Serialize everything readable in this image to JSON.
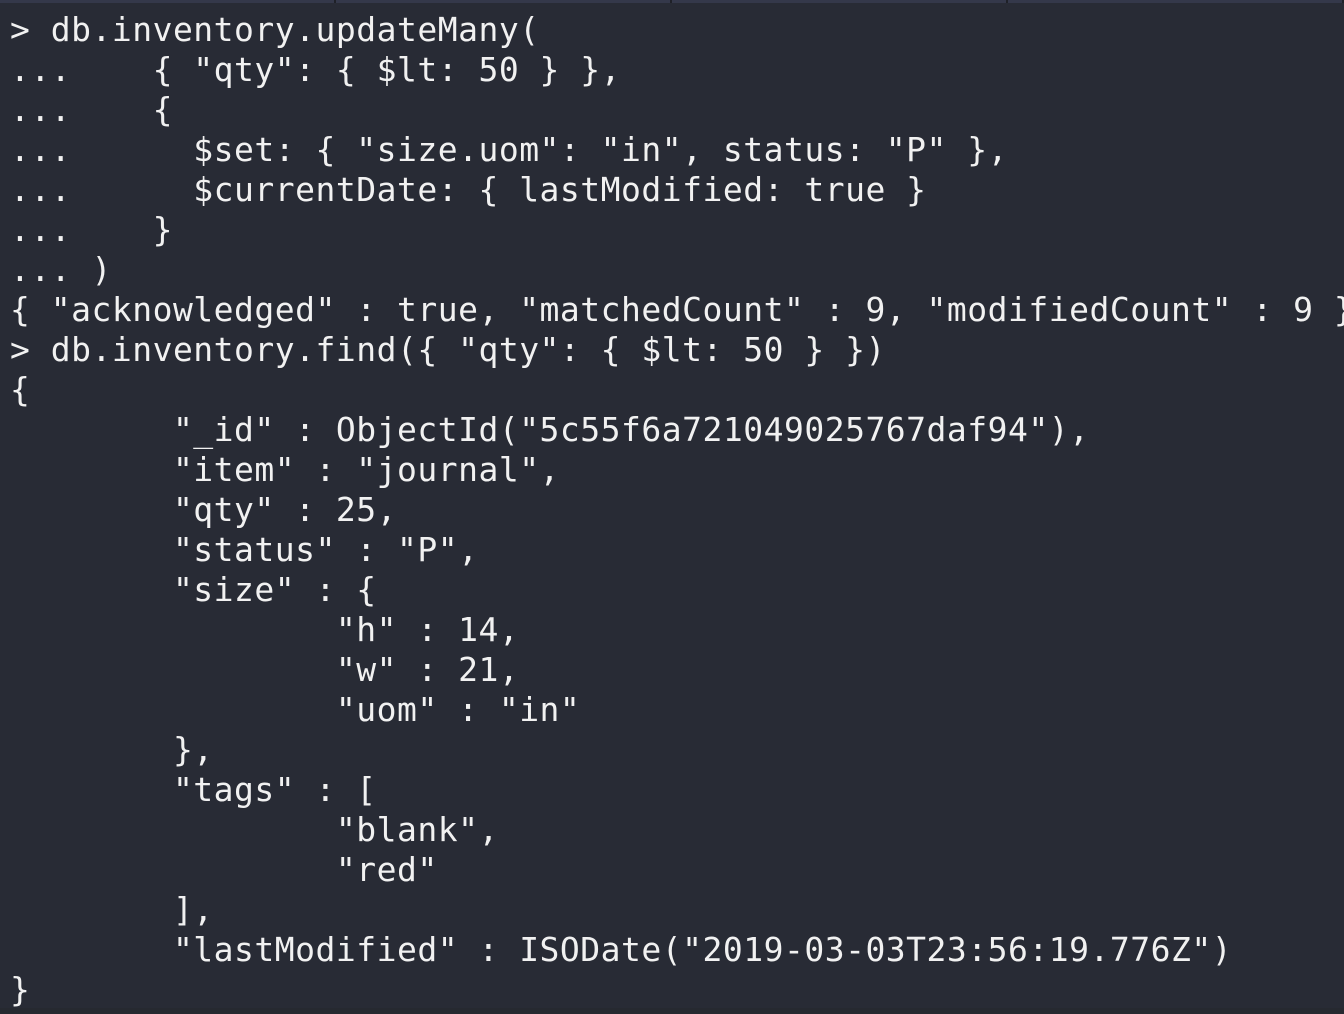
{
  "terminal": {
    "lines": [
      "> db.inventory.updateMany(",
      "...    { \"qty\": { $lt: 50 } },",
      "...    {",
      "...      $set: { \"size.uom\": \"in\", status: \"P\" },",
      "...      $currentDate: { lastModified: true }",
      "...    }",
      "... )",
      "{ \"acknowledged\" : true, \"matchedCount\" : 9, \"modifiedCount\" : 9 }",
      "> db.inventory.find({ \"qty\": { $lt: 50 } })",
      "{",
      "        \"_id\" : ObjectId(\"5c55f6a721049025767daf94\"),",
      "        \"item\" : \"journal\",",
      "        \"qty\" : 25,",
      "        \"status\" : \"P\",",
      "        \"size\" : {",
      "                \"h\" : 14,",
      "                \"w\" : 21,",
      "                \"uom\" : \"in\"",
      "        },",
      "        \"tags\" : [",
      "                \"blank\",",
      "                \"red\"",
      "        ],",
      "        \"lastModified\" : ISODate(\"2019-03-03T23:56:19.776Z\")",
      "}"
    ]
  }
}
